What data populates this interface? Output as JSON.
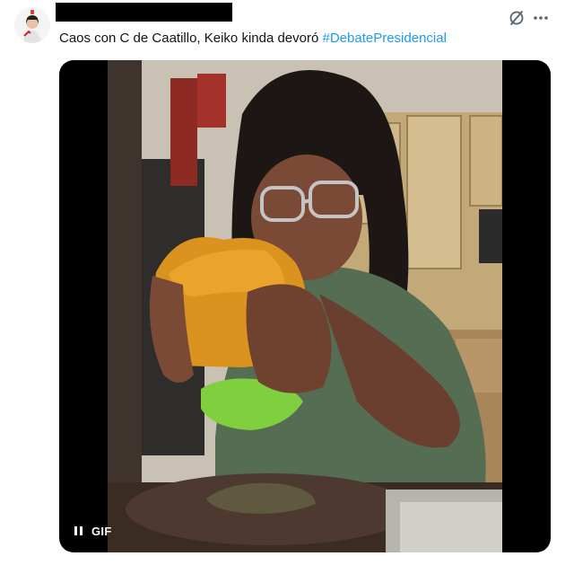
{
  "tweet": {
    "text_main": "Caos con C de Caatillo, Keiko kinda devoró ",
    "hashtag": "#DebatePresidencial"
  },
  "media": {
    "badge": "GIF",
    "caption_text_visible": false
  },
  "icons": {
    "grok": "slashed-circle-icon",
    "more": "more-horizontal-icon",
    "pause": "pause-icon"
  },
  "colors": {
    "text": "#0f1419",
    "hashtag": "#1d9bf0",
    "icon": "#536471"
  }
}
